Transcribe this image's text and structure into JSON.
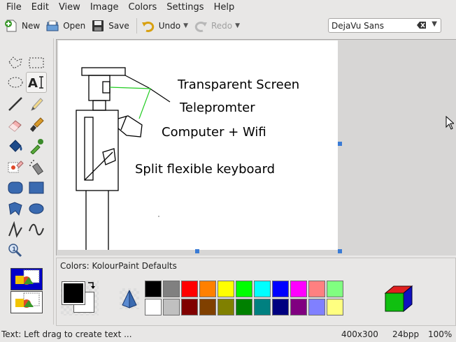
{
  "menubar": {
    "items": [
      "File",
      "Edit",
      "View",
      "Image",
      "Colors",
      "Settings",
      "Help"
    ]
  },
  "toolbar": {
    "new_label": "New",
    "open_label": "Open",
    "save_label": "Save",
    "undo_label": "Undo",
    "redo_label": "Redo",
    "font_value": "DejaVu Sans"
  },
  "tools": [
    "free-form-selection",
    "rectangular-selection",
    "elliptical-selection",
    "text-tool",
    "line-tool",
    "pen-tool",
    "eraser-tool",
    "brush-tool",
    "flood-fill-tool",
    "color-picker-tool",
    "color-eraser-tool",
    "spraycan-tool",
    "rounded-rectangle-tool",
    "rectangle-tool",
    "polygon-tool",
    "ellipse-tool",
    "polyline-tool",
    "curve-tool",
    "zoom-tool"
  ],
  "canvas": {
    "labels": [
      "Transparent Screen",
      "Telepromter",
      "Computer + Wifi",
      "Split flexible keyboard"
    ]
  },
  "colors_panel": {
    "label": "Colors: KolourPaint Defaults",
    "foreground": "#000000",
    "background": "#ffffff",
    "row1": [
      "#000000",
      "#808080",
      "#ff0000",
      "#ff8000",
      "#ffff00",
      "#00ff00",
      "#00ffff",
      "#0000ff",
      "#ff00ff",
      "#ff8080",
      "#80ff80"
    ],
    "row2": [
      "#ffffff",
      "#c0c0c0",
      "#800000",
      "#804000",
      "#808000",
      "#008000",
      "#008080",
      "#000080",
      "#800080",
      "#8080ff",
      "#ffff80"
    ]
  },
  "statusbar": {
    "text": "Text: Left drag to create text ...",
    "dimensions": "400x300",
    "depth": "24bpp",
    "zoom": "100%"
  }
}
